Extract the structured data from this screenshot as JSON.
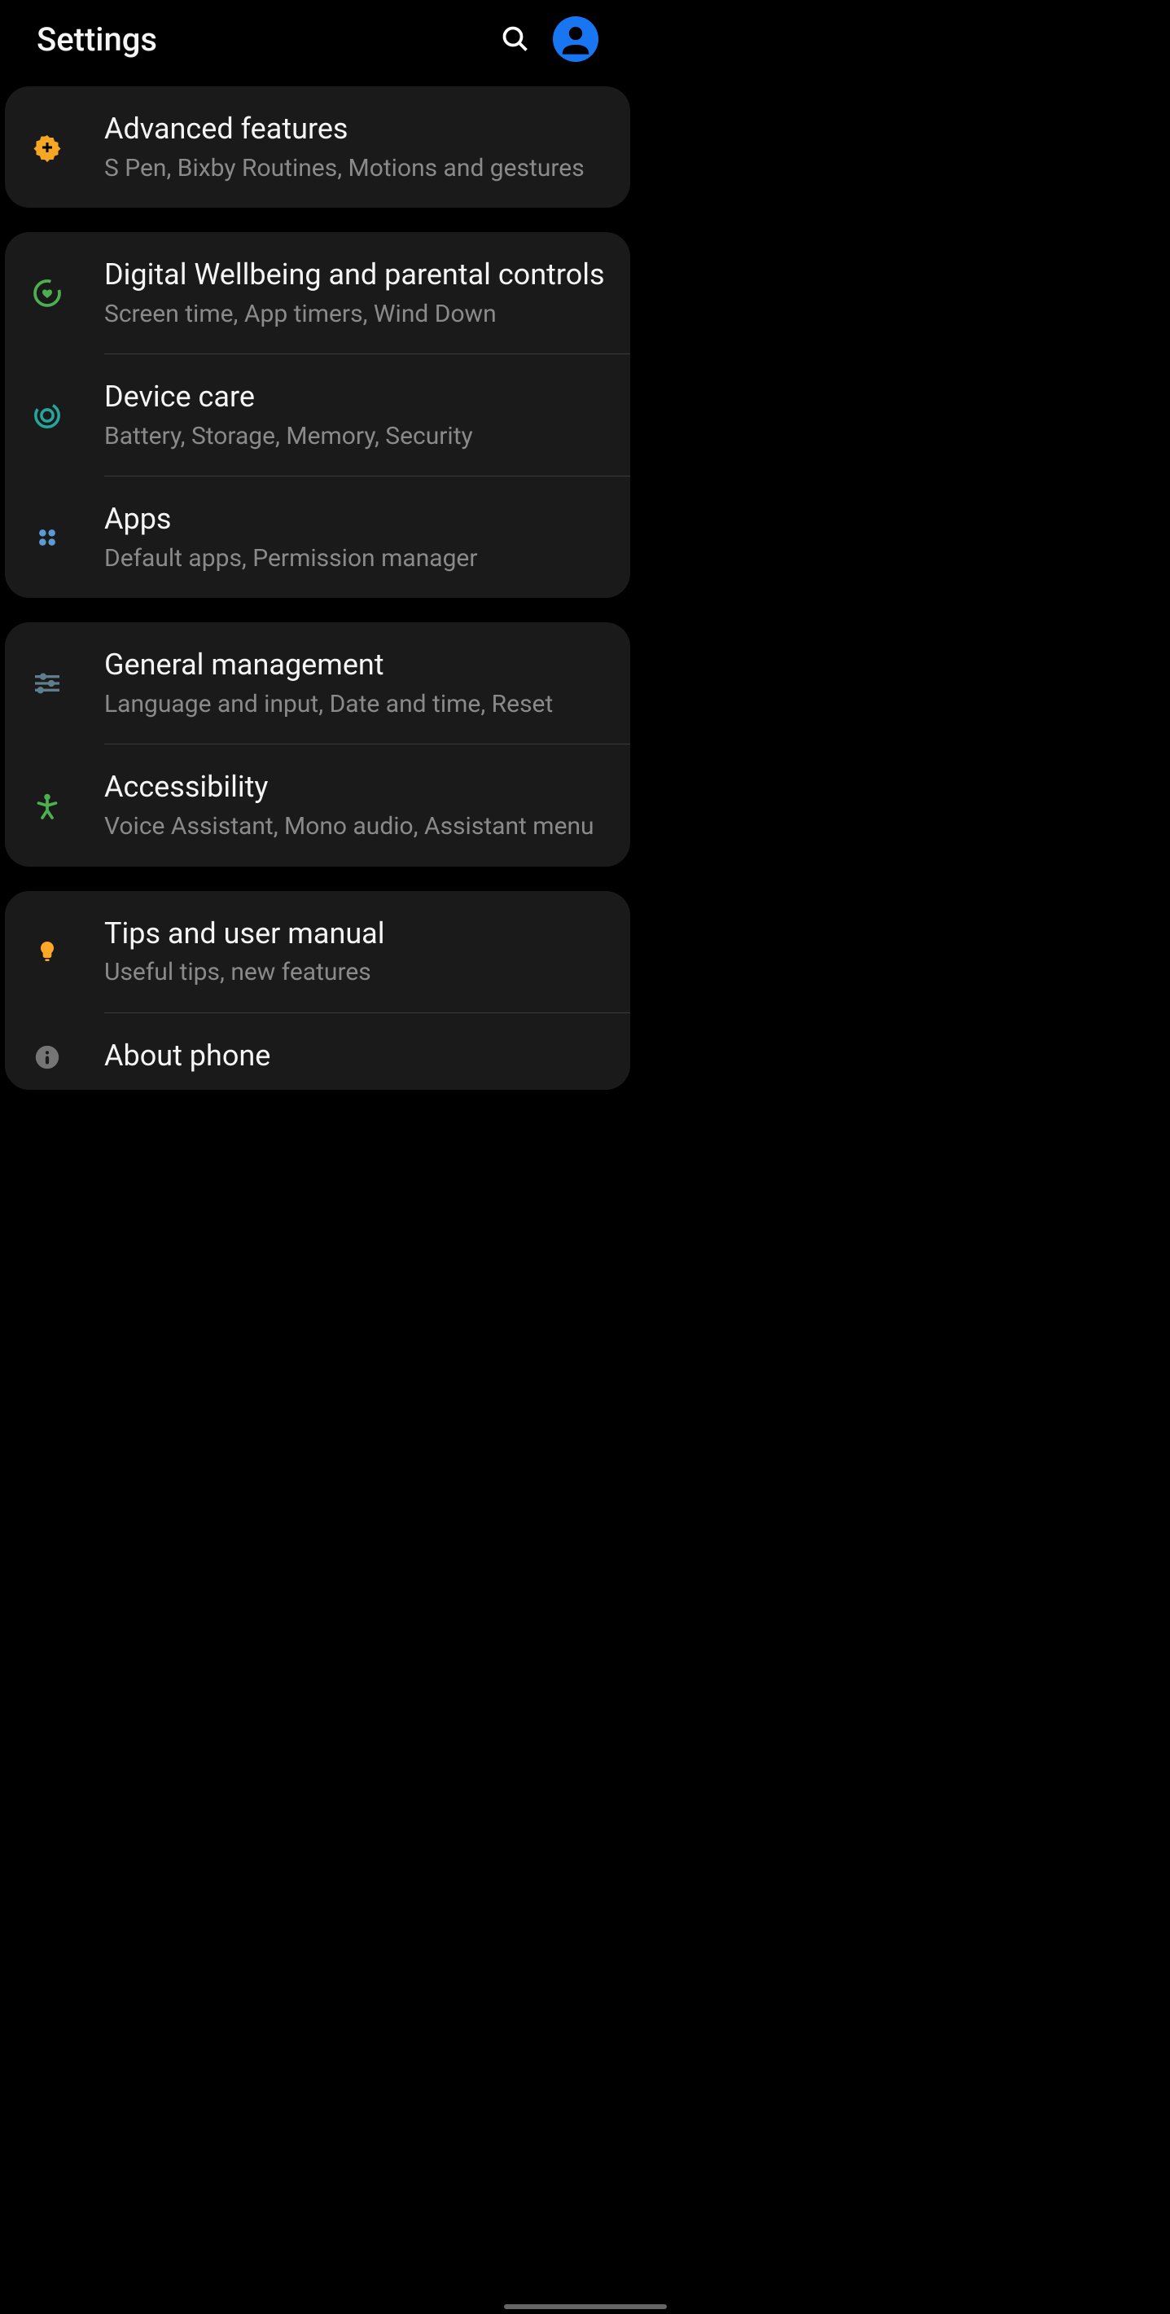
{
  "header": {
    "title": "Settings"
  },
  "groups": [
    {
      "items": [
        {
          "id": "advanced-features",
          "title": "Advanced features",
          "subtitle": "S Pen, Bixby Routines, Motions and gestures",
          "icon": "gear-plus",
          "iconColor": "#f5a623"
        }
      ]
    },
    {
      "items": [
        {
          "id": "digital-wellbeing",
          "title": "Digital Wellbeing and parental controls",
          "subtitle": "Screen time, App timers, Wind Down",
          "icon": "heart-circle",
          "iconColor": "#4caf50"
        },
        {
          "id": "device-care",
          "title": "Device care",
          "subtitle": "Battery, Storage, Memory, Security",
          "icon": "refresh-circle",
          "iconColor": "#26a69a"
        },
        {
          "id": "apps",
          "title": "Apps",
          "subtitle": "Default apps, Permission manager",
          "icon": "grid-dots",
          "iconColor": "#5b9bd5"
        }
      ]
    },
    {
      "items": [
        {
          "id": "general-management",
          "title": "General management",
          "subtitle": "Language and input, Date and time, Reset",
          "icon": "sliders",
          "iconColor": "#607d8b"
        },
        {
          "id": "accessibility",
          "title": "Accessibility",
          "subtitle": "Voice Assistant, Mono audio, Assistant menu",
          "icon": "person-arms",
          "iconColor": "#4caf50"
        }
      ]
    },
    {
      "items": [
        {
          "id": "tips",
          "title": "Tips and user manual",
          "subtitle": "Useful tips, new features",
          "icon": "lightbulb",
          "iconColor": "#ffa726"
        },
        {
          "id": "about-phone",
          "title": "About phone",
          "subtitle": "",
          "icon": "info",
          "iconColor": "#757575"
        }
      ]
    }
  ]
}
